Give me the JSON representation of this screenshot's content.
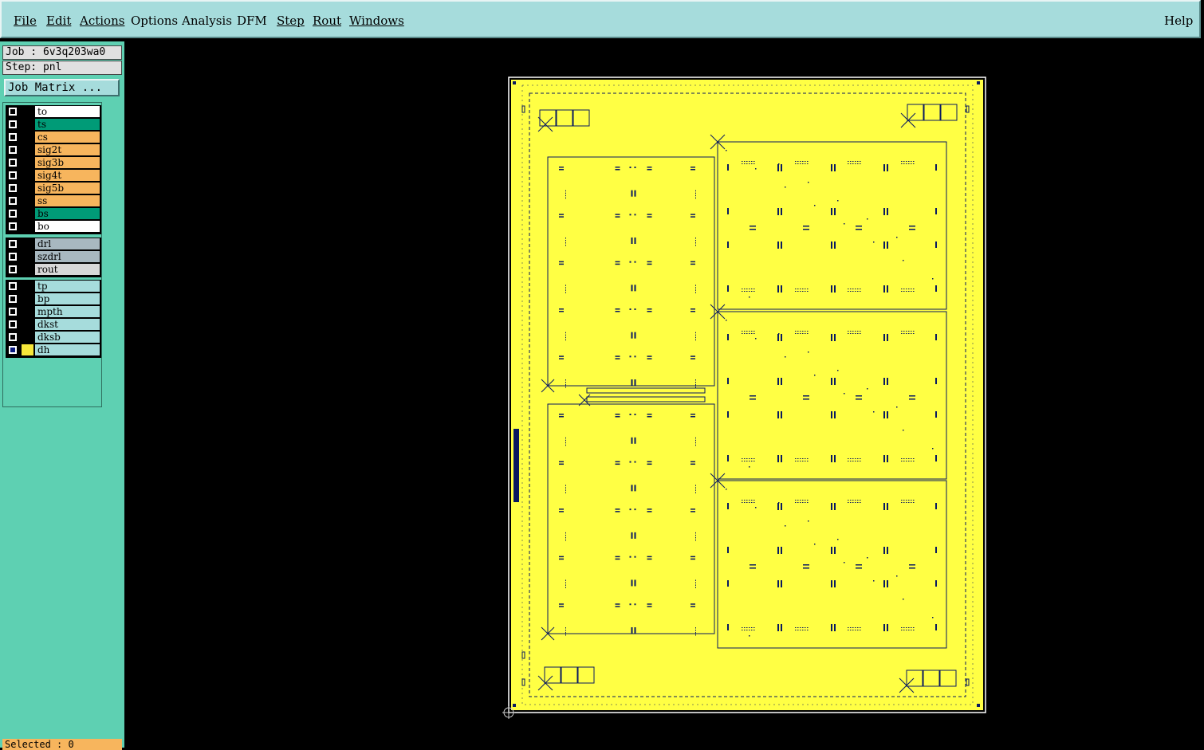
{
  "menu": {
    "items": [
      {
        "label": "File",
        "key": "file"
      },
      {
        "label": "Edit",
        "key": "edit"
      },
      {
        "label": "Actions",
        "key": "actions"
      },
      {
        "label": "Options",
        "key": "options"
      },
      {
        "label": "Analysis",
        "key": "analysis"
      },
      {
        "label": "DFM",
        "key": "dfm"
      },
      {
        "label": "Step",
        "key": "step"
      },
      {
        "label": "Rout",
        "key": "rout"
      },
      {
        "label": "Windows",
        "key": "windows"
      }
    ],
    "help": "Help"
  },
  "panel": {
    "job": "Job : 6v3q203wa0",
    "step": "Step: pnl",
    "job_matrix": "Job Matrix ...",
    "selected": "Selected : 0"
  },
  "layers": {
    "board": [
      {
        "name": "to",
        "color": "#ffffff"
      },
      {
        "name": "ts",
        "color": "#009b77"
      },
      {
        "name": "cs",
        "color": "#f7b55d"
      },
      {
        "name": "sig2t",
        "color": "#f7b55d"
      },
      {
        "name": "sig3b",
        "color": "#f7b55d"
      },
      {
        "name": "sig4t",
        "color": "#f7b55d"
      },
      {
        "name": "sig5b",
        "color": "#f7b55d"
      },
      {
        "name": "ss",
        "color": "#f7b55d"
      },
      {
        "name": "bs",
        "color": "#009b77"
      },
      {
        "name": "bo",
        "color": "#ffffff"
      }
    ],
    "drill": [
      {
        "name": "drl",
        "color": "#a8b8c0"
      },
      {
        "name": "szdrl",
        "color": "#a8b8c0"
      },
      {
        "name": "rout",
        "color": "#d8d8d8"
      }
    ],
    "misc": [
      {
        "name": "tp",
        "color": "#a6dcdc"
      },
      {
        "name": "bp",
        "color": "#a6dcdc"
      },
      {
        "name": "mpth",
        "color": "#a6dcdc"
      },
      {
        "name": "dkst",
        "color": "#a6dcdc"
      },
      {
        "name": "dksb",
        "color": "#a6dcdc"
      },
      {
        "name": "dh",
        "color": "#a6dcdc",
        "active": true,
        "display_color": "#f7e83a"
      }
    ]
  },
  "colors": {
    "panel_fill": "#ffff44",
    "outline": "#0a1a60",
    "menu_bg": "#a6dcdc",
    "sidebar_bg": "#5ed0b2"
  }
}
